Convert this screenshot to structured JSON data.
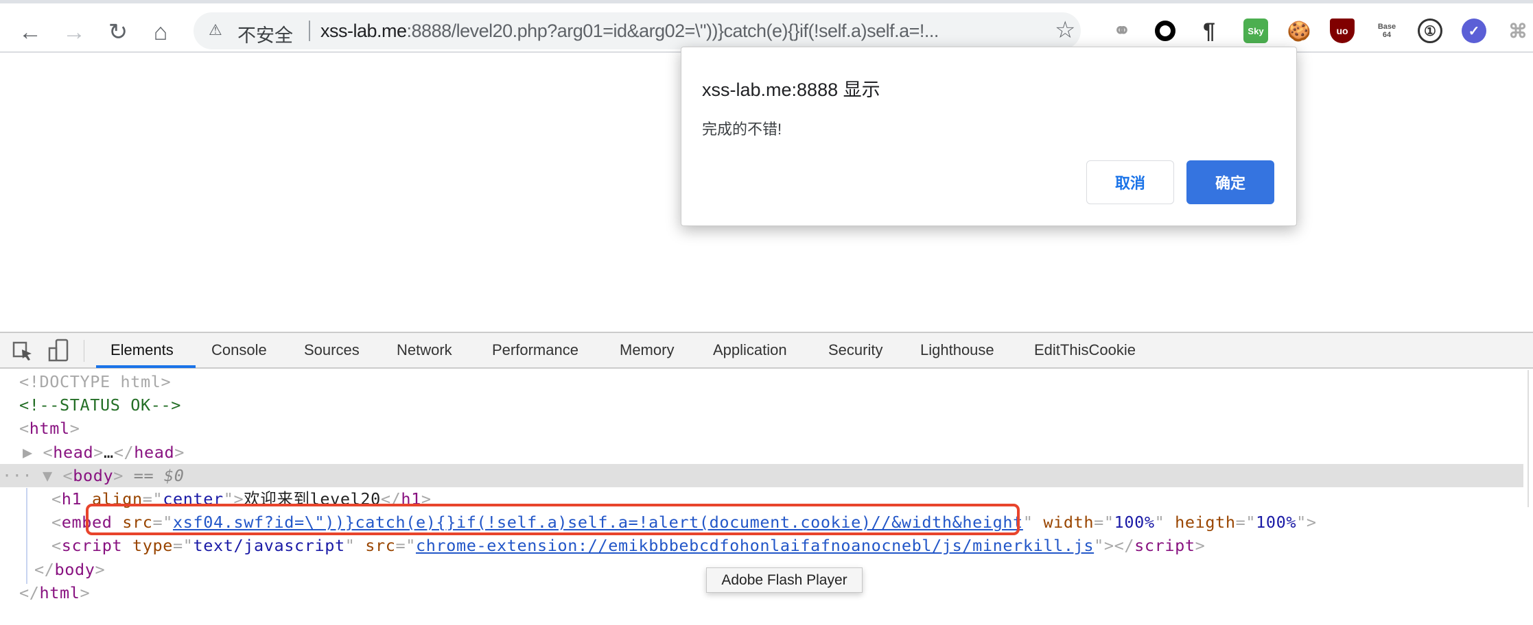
{
  "browser": {
    "nav": {
      "back": "←",
      "forward": "→",
      "reload": "↻",
      "home": "⌂"
    },
    "omnibox": {
      "warning_icon": "⚠",
      "security_label": "不安全",
      "url_host": "xss-lab.me",
      "url_rest": ":8888/level20.php?arg01=id&arg02=\\\"))}catch(e){}if(!self.a)self.a=!...",
      "star": "☆"
    },
    "extensions": [
      {
        "name": "chain-extension-icon",
        "glyph": "⚭"
      },
      {
        "name": "circle-extension-icon",
        "glyph": ""
      },
      {
        "name": "pilcrow-extension-icon",
        "glyph": "¶"
      },
      {
        "name": "sky-extension-icon",
        "glyph": "Sky"
      },
      {
        "name": "cookie-extension-icon",
        "glyph": "🍪"
      },
      {
        "name": "ublock-extension-icon",
        "glyph": "uo"
      },
      {
        "name": "base64-extension-icon",
        "glyph": "Base 64"
      },
      {
        "name": "1password-extension-icon",
        "glyph": "①"
      },
      {
        "name": "check-extension-icon",
        "glyph": "✓"
      },
      {
        "name": "puzzle-extension-icon",
        "glyph": "⌘"
      }
    ]
  },
  "dialog": {
    "title": "xss-lab.me:8888 显示",
    "message": "完成的不错!",
    "cancel": "取消",
    "ok": "确定"
  },
  "devtools": {
    "tabs": [
      "Elements",
      "Console",
      "Sources",
      "Network",
      "Performance",
      "Memory",
      "Application",
      "Security",
      "Lighthouse",
      "EditThisCookie"
    ],
    "active_tab": "Elements",
    "lines": [
      [
        [
          "doc",
          "<!DOCTYPE html>"
        ]
      ],
      [
        [
          "cm",
          "<!--STATUS OK-->"
        ]
      ],
      [
        [
          "br",
          "<"
        ],
        [
          "tag",
          "html"
        ],
        [
          "br",
          ">"
        ]
      ],
      [
        [
          "br",
          "▶ "
        ],
        [
          "br",
          "<"
        ],
        [
          "tag",
          "head"
        ],
        [
          "br",
          ">"
        ],
        [
          "txt",
          "…"
        ],
        [
          "br",
          "</"
        ],
        [
          "tag",
          "head"
        ],
        [
          "br",
          ">"
        ]
      ],
      [
        [
          "br",
          "··· ▼ "
        ],
        [
          "br",
          "<"
        ],
        [
          "tag",
          "body"
        ],
        [
          "br",
          ">"
        ],
        [
          "dim",
          " == $0"
        ]
      ],
      [
        [
          "br",
          "<"
        ],
        [
          "tag",
          "h1"
        ],
        [
          "attr",
          " align"
        ],
        [
          "br",
          "=\""
        ],
        [
          "val",
          "center"
        ],
        [
          "br",
          "\">"
        ],
        [
          "txt",
          "欢迎来到level20"
        ],
        [
          "br",
          "</"
        ],
        [
          "tag",
          "h1"
        ],
        [
          "br",
          ">"
        ]
      ],
      [
        [
          "br",
          "<"
        ],
        [
          "tag",
          "embed"
        ],
        [
          "attr",
          " src"
        ],
        [
          "br",
          "=\""
        ],
        [
          "link",
          "xsf04.swf?id=\\\"))}catch(e){}if(!self.a)self.a=!alert(document.cookie)//&width&height"
        ],
        [
          "br",
          "\""
        ],
        [
          "attr",
          " width"
        ],
        [
          "br",
          "=\""
        ],
        [
          "val",
          "100%"
        ],
        [
          "br",
          "\""
        ],
        [
          "attr",
          " heigth"
        ],
        [
          "br",
          "=\""
        ],
        [
          "val",
          "100%"
        ],
        [
          "br",
          "\">"
        ]
      ],
      [
        [
          "br",
          "<"
        ],
        [
          "tag",
          "script"
        ],
        [
          "attr",
          " type"
        ],
        [
          "br",
          "=\""
        ],
        [
          "val",
          "text/javascript"
        ],
        [
          "br",
          "\""
        ],
        [
          "attr",
          " src"
        ],
        [
          "br",
          "=\""
        ],
        [
          "link",
          "chrome-extension://emikbbbebcdfohonlaifafnoanocnebl/js/minerkill.js"
        ],
        [
          "br",
          "\">"
        ],
        [
          "br",
          "</"
        ],
        [
          "tag",
          "script"
        ],
        [
          "br",
          ">"
        ]
      ],
      [
        [
          "br",
          "</"
        ],
        [
          "tag",
          "body"
        ],
        [
          "br",
          ">"
        ]
      ],
      [
        [
          "br",
          "</"
        ],
        [
          "tag",
          "html"
        ],
        [
          "br",
          ">"
        ]
      ]
    ],
    "tooltip": "Adobe Flash Player"
  }
}
